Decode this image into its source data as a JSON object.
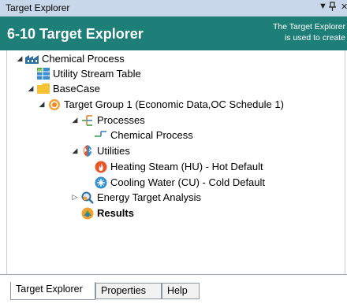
{
  "window": {
    "title": "Target Explorer",
    "controls": {
      "dropdown": "▼",
      "pin": "ᵖ",
      "close": "✕"
    }
  },
  "header": {
    "title": "6-10 Target Explorer",
    "description_line1": "The Target Explorer",
    "description_line2": "is used to create",
    "color": "#1e7f78"
  },
  "tree": {
    "root": "Chemical Process",
    "utility_table": "Utility Stream Table",
    "basecase": "BaseCase",
    "target_group": "Target Group 1 (Economic Data,OC Schedule 1)",
    "processes": "Processes",
    "process_item": "Chemical Process",
    "utilities": "Utilities",
    "hot_utility": "Heating Steam (HU) - Hot Default",
    "cold_utility": "Cooling Water (CU) - Cold Default",
    "energy_target": "Energy Target Analysis",
    "results": "Results"
  },
  "icons": {
    "root": "chemical-process-icon",
    "table": "table-icon",
    "folder": "folder-icon",
    "target": "target-group-icon",
    "processes": "processes-icon",
    "process": "process-item-icon",
    "utilities": "utilities-icon",
    "hot": "flame-icon",
    "cold": "snowflake-icon",
    "search": "magnifier-icon",
    "results": "results-icon"
  },
  "tabs": [
    "Target Explorer",
    "Properties",
    "Help"
  ],
  "active_tab": "Target Explorer"
}
